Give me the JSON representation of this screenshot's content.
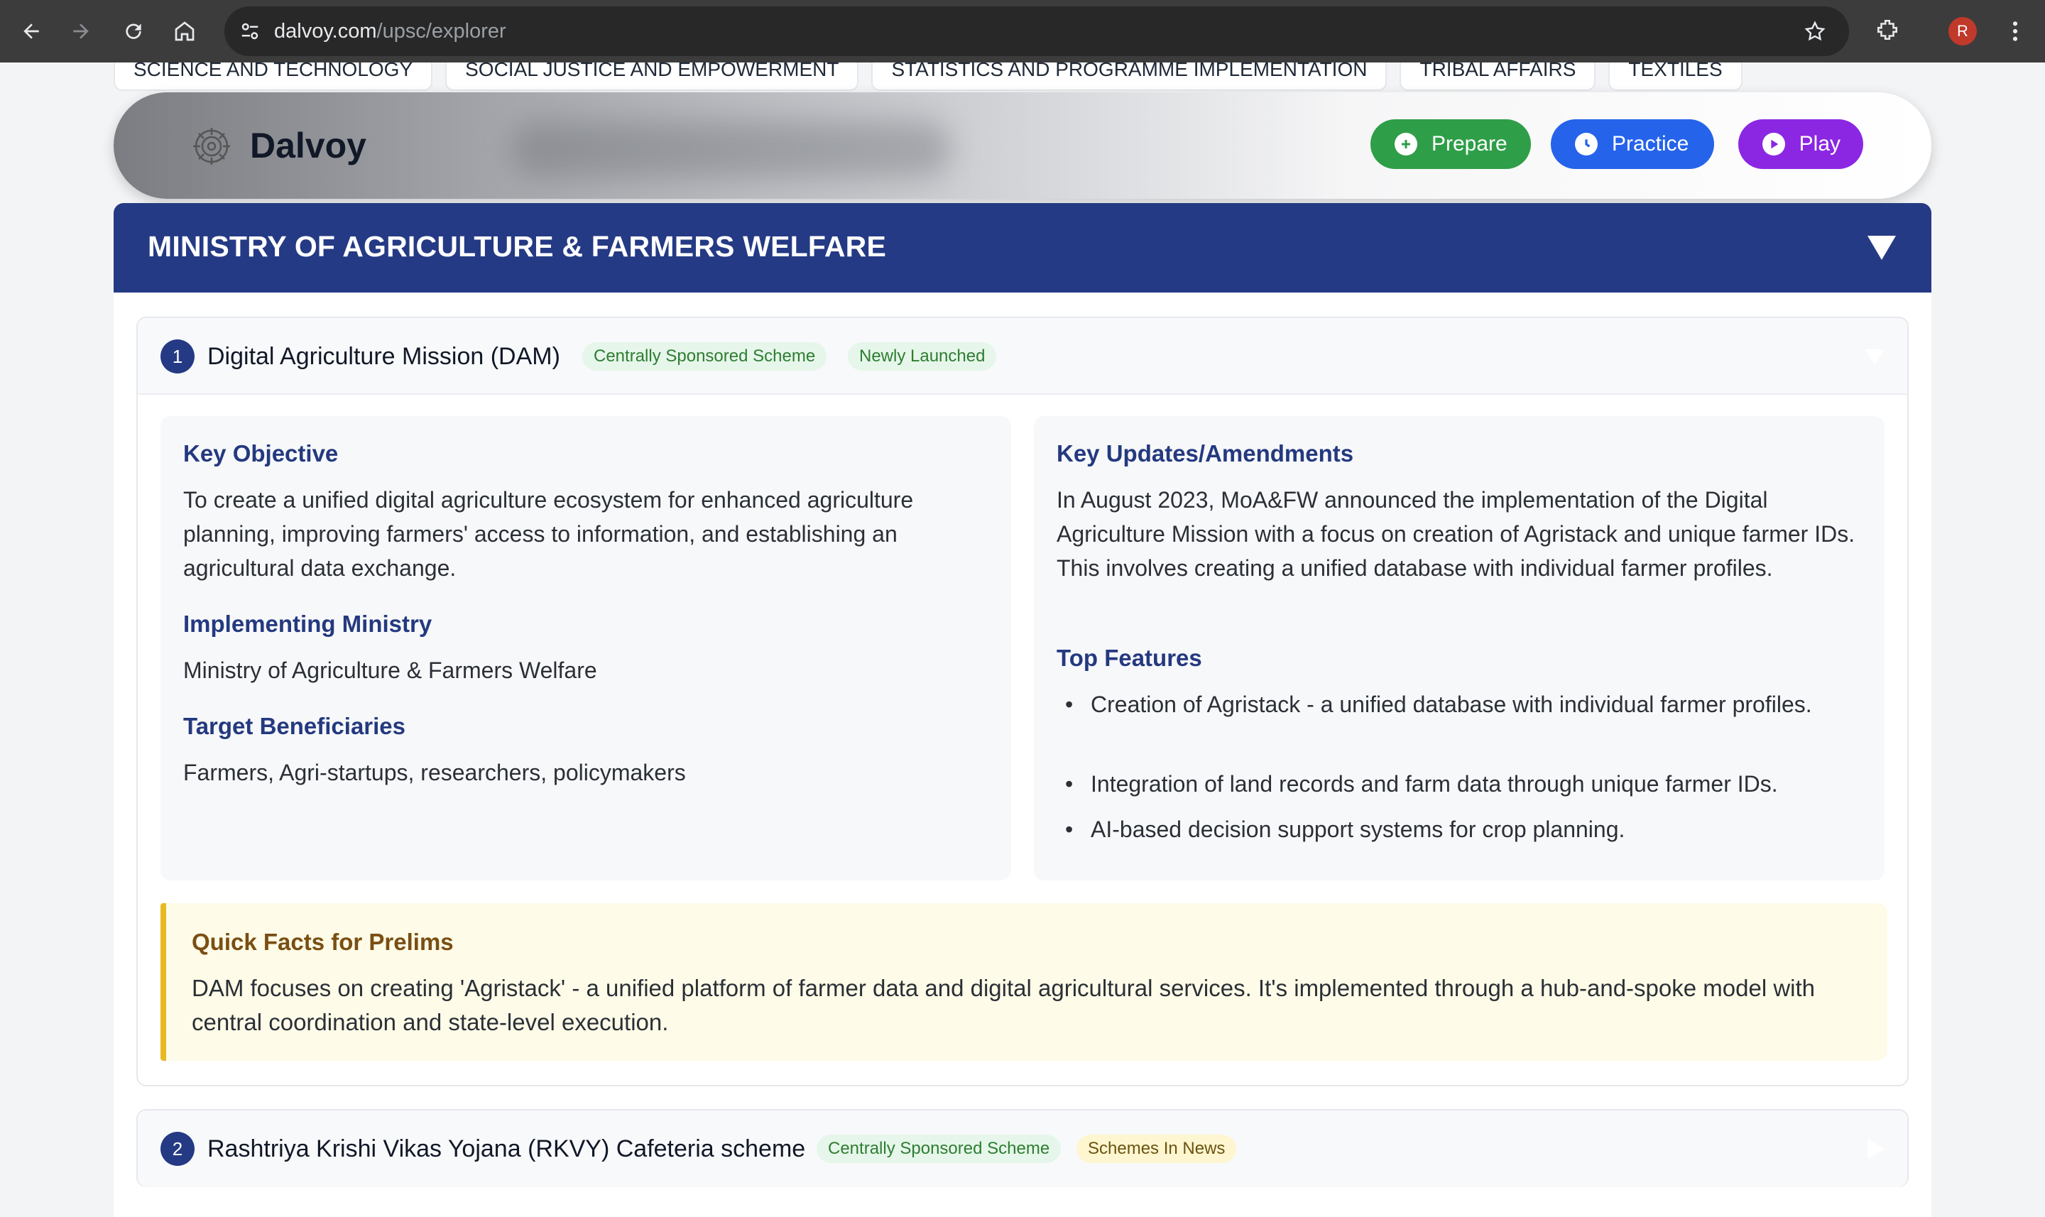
{
  "browser": {
    "url_host": "dalvoy.com",
    "url_path": "/upsc/explorer",
    "profile_initial": "R"
  },
  "ministry_tabs": [
    "SCIENCE AND TECHNOLOGY",
    "SOCIAL JUSTICE AND EMPOWERMENT",
    "STATISTICS AND PROGRAMME IMPLEMENTATION",
    "TRIBAL AFFAIRS",
    "TEXTILES"
  ],
  "header": {
    "brand": "Dalvoy",
    "buttons": {
      "prepare": "Prepare",
      "practice": "Practice",
      "play": "Play"
    },
    "colors": {
      "prepare": "#2f9e48",
      "practice": "#2563eb",
      "play": "#8b27e3"
    }
  },
  "ministry": {
    "title": "MINISTRY OF AGRICULTURE & FARMERS WELFARE",
    "color": "#253a84"
  },
  "schemes": [
    {
      "number": "1",
      "title": "Digital Agriculture Mission (DAM)",
      "badges": [
        "Centrally Sponsored Scheme",
        "Newly Launched"
      ],
      "key_objective_heading": "Key Objective",
      "key_objective": "To create a unified digital agriculture ecosystem for enhanced agriculture planning, improving farmers' access to information, and establishing an agricultural data exchange.",
      "implementing_ministry_heading": "Implementing Ministry",
      "implementing_ministry": "Ministry of Agriculture & Farmers Welfare",
      "target_beneficiaries_heading": "Target Beneficiaries",
      "target_beneficiaries": "Farmers, Agri-startups, researchers, policymakers",
      "key_updates_heading": "Key Updates/Amendments",
      "key_updates": "In August 2023, MoA&FW announced the implementation of the Digital Agriculture Mission with a focus on creation of Agristack and unique farmer IDs. This involves creating a unified database with individual farmer profiles.",
      "top_features_heading": "Top Features",
      "top_features": [
        "Creation of Agristack - a unified database with individual farmer profiles.",
        "Integration of land records and farm data through unique farmer IDs.",
        "AI-based decision support systems for crop planning."
      ],
      "quick_facts_heading": "Quick Facts for Prelims",
      "quick_facts": "DAM focuses on creating 'Agristack' - a unified platform of farmer data and digital agricultural services. It's implemented through a hub-and-spoke model with central coordination and state-level execution."
    },
    {
      "number": "2",
      "title": "Rashtriya Krishi Vikas Yojana (RKVY) Cafeteria scheme",
      "badges": [
        "Centrally Sponsored Scheme",
        "Schemes In News"
      ]
    }
  ]
}
